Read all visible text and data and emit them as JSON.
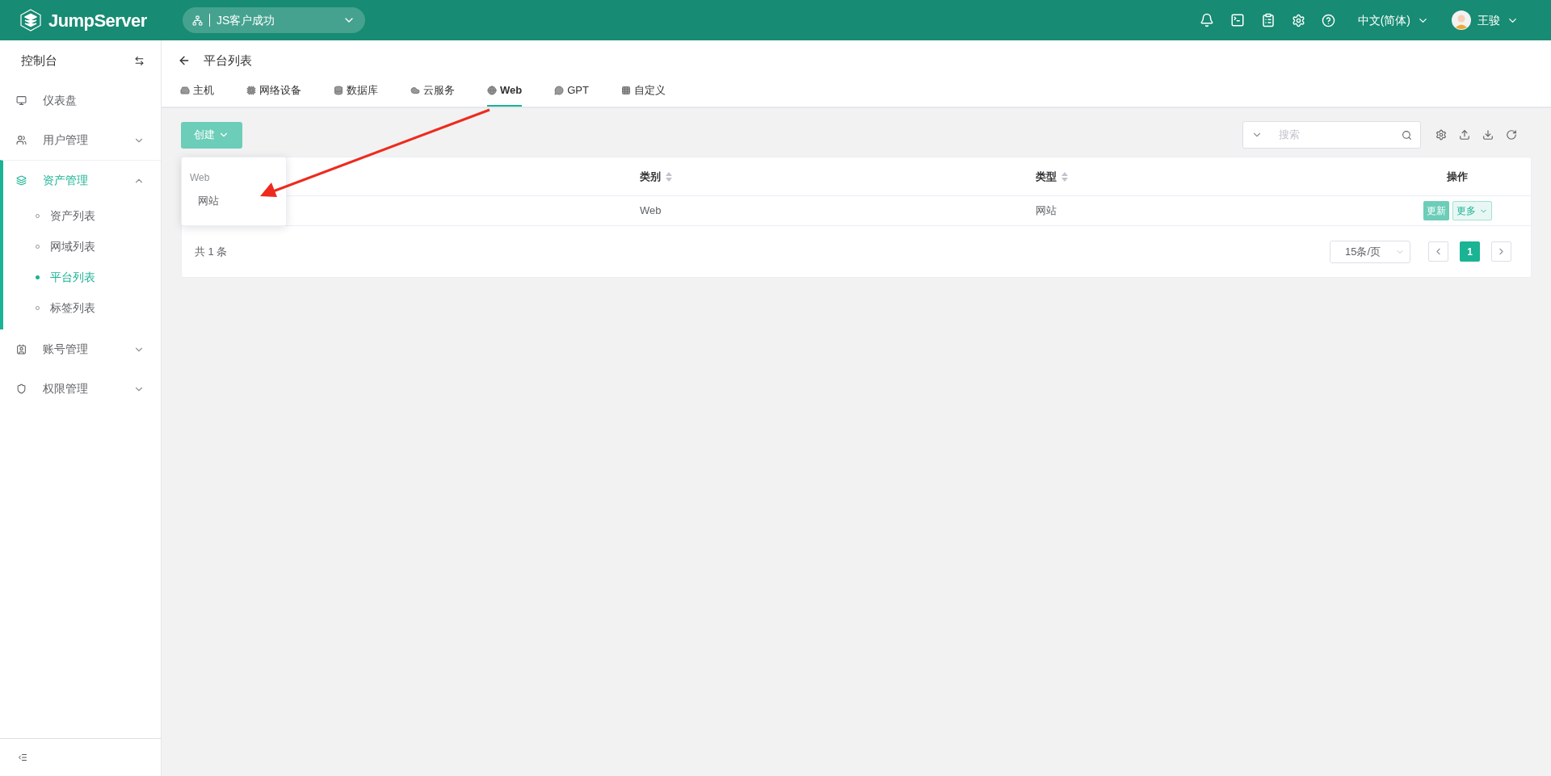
{
  "header": {
    "logo_text": "JumpServer",
    "org_selector": "JS客户成功",
    "language": "中文(简体)",
    "user": "王骏"
  },
  "sidebar": {
    "title": "控制台",
    "items": [
      {
        "label": "仪表盘",
        "kind": "link",
        "selected": false
      },
      {
        "label": "用户管理",
        "kind": "group",
        "expanded": false
      },
      {
        "label": "资产管理",
        "kind": "group",
        "expanded": true,
        "children": [
          {
            "label": "资产列表",
            "selected": false
          },
          {
            "label": "网域列表",
            "selected": false
          },
          {
            "label": "平台列表",
            "selected": true
          },
          {
            "label": "标签列表",
            "selected": false
          }
        ]
      },
      {
        "label": "账号管理",
        "kind": "group",
        "expanded": false
      },
      {
        "label": "权限管理",
        "kind": "group",
        "expanded": false
      }
    ]
  },
  "page": {
    "title": "平台列表",
    "tabs": [
      {
        "label": "主机",
        "selected": false
      },
      {
        "label": "网络设备",
        "selected": false
      },
      {
        "label": "数据库",
        "selected": false
      },
      {
        "label": "云服务",
        "selected": false
      },
      {
        "label": "Web",
        "selected": true
      },
      {
        "label": "GPT",
        "selected": false
      },
      {
        "label": "自定义",
        "selected": false
      }
    ]
  },
  "toolbar": {
    "create_button": "创建",
    "search": {
      "placeholder": "搜索"
    }
  },
  "create_menu": {
    "group": "Web",
    "items": [
      "网站"
    ]
  },
  "table": {
    "columns": [
      {
        "label": "类别",
        "sortable": true
      },
      {
        "label": "类型",
        "sortable": true
      },
      {
        "label": "操作",
        "sortable": false
      }
    ],
    "rows": [
      {
        "cells": [
          "Web",
          "网站"
        ],
        "actions": [
          "更新",
          "更多"
        ]
      }
    ]
  },
  "footer": {
    "total": "共 1 条",
    "page_size": "15条/页",
    "pages": [
      {
        "label": "1",
        "selected": true
      }
    ]
  }
}
